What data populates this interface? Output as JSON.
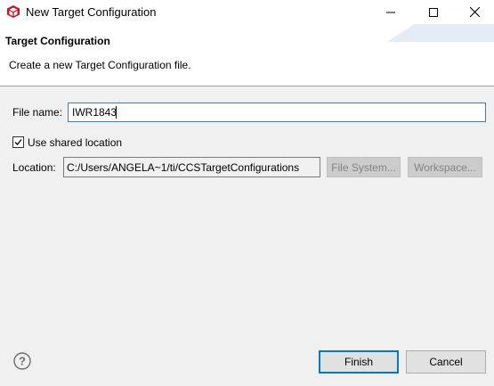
{
  "window": {
    "title": "New Target Configuration",
    "controls": {
      "minimize": "minimize-icon",
      "maximize": "maximize-icon",
      "close": "close-icon"
    }
  },
  "header": {
    "title": "Target Configuration",
    "description": "Create a new Target Configuration file."
  },
  "form": {
    "file_name_label": "File name:",
    "file_name_value": "IWR1843",
    "use_shared_label": "Use shared location",
    "use_shared_checked": true,
    "location_label": "Location:",
    "location_value": "C:/Users/ANGELA~1/ti/CCSTargetConfigurations",
    "file_system_button": "File System...",
    "workspace_button": "Workspace..."
  },
  "footer": {
    "help_icon": "help-icon",
    "finish_button": "Finish",
    "cancel_button": "Cancel"
  },
  "colors": {
    "accent": "#0078d7",
    "app_icon": "#c4161c"
  }
}
